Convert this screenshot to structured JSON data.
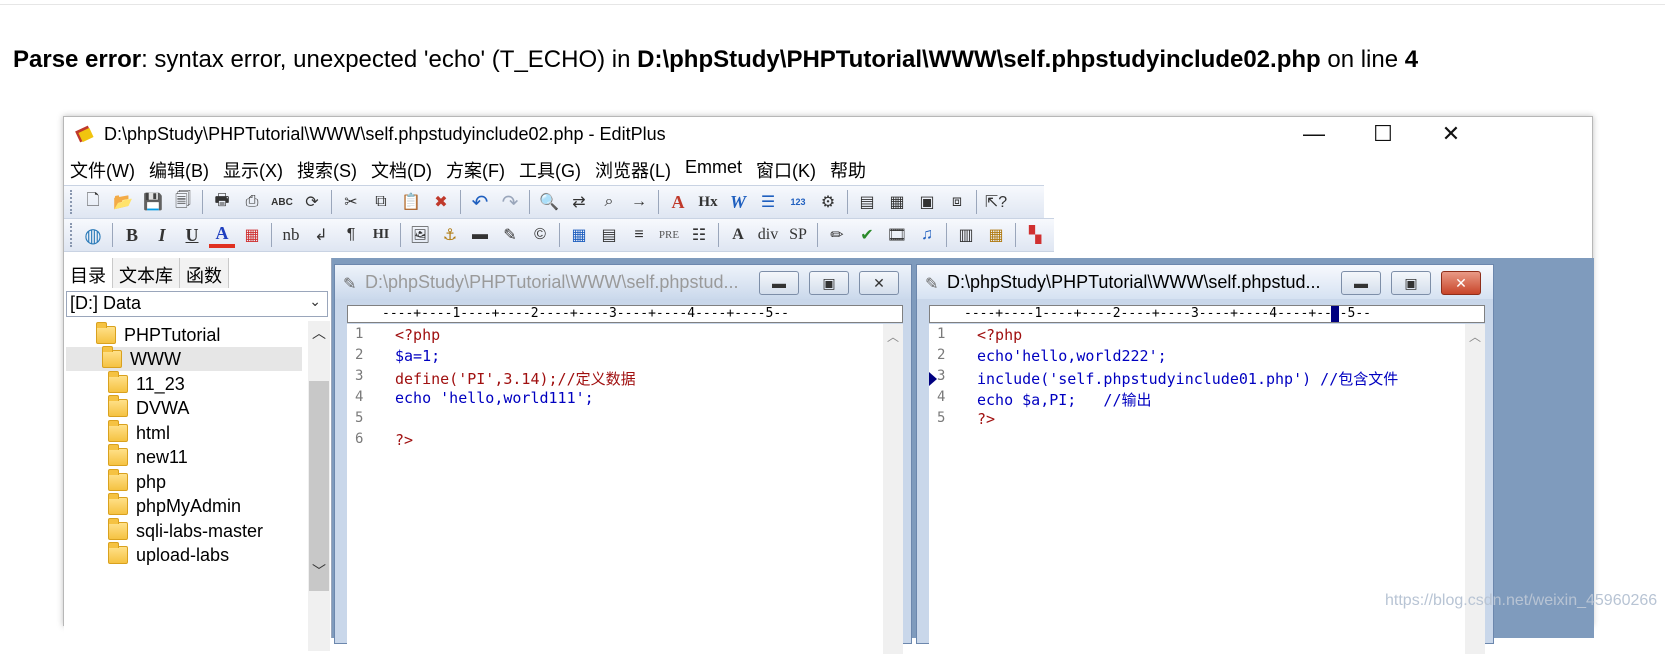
{
  "page_error": {
    "label": "Parse error",
    "message_part1": ": syntax error, unexpected 'echo' (T_ECHO) in ",
    "file": "D:\\phpStudy\\PHPTutorial\\WWW\\self.phpstudyinclude02.php",
    "message_part2": " on line ",
    "line": "4"
  },
  "window": {
    "title": "D:\\phpStudy\\PHPTutorial\\WWW\\self.phpstudyinclude02.php - EditPlus",
    "minimize": "—",
    "maximize": "☐",
    "close": "✕"
  },
  "menu": [
    "文件(W)",
    "编辑(B)",
    "显示(X)",
    "搜索(S)",
    "文档(D)",
    "方案(F)",
    "工具(G)",
    "浏览器(L)",
    "Emmet",
    "窗口(K)",
    "帮助"
  ],
  "toolbar1": {
    "icons": [
      "new-file-icon",
      "open-folder-icon",
      "save-icon",
      "save-all-icon",
      "print-preview-icon",
      "print-icon",
      "spell-check-icon",
      "browser-icon",
      "cut-icon",
      "copy-icon",
      "paste-icon",
      "delete-icon",
      "undo-icon",
      "redo-icon",
      "find-icon",
      "replace-icon",
      "find-in-files-icon",
      "goto-line-icon",
      "font-icon",
      "hex-icon",
      "word-wrap-icon",
      "indent-icon",
      "column-icon",
      "settings-icon",
      "cliptext-icon",
      "directory-icon",
      "output-icon",
      "run-icon",
      "help-icon"
    ],
    "hx_label": "Hx",
    "abc_label": "ABC"
  },
  "toolbar2": {
    "bold": "B",
    "italic": "I",
    "underline": "U",
    "font_color": "A",
    "nbsp": "nb",
    "br": "↲",
    "para": "¶",
    "hr": "HI",
    "pre": "PRE",
    "div": "div",
    "span": "SP"
  },
  "sidebar": {
    "tabs": [
      "目录",
      "文本库",
      "函数"
    ],
    "drive": "[D:] Data",
    "tree": [
      "PHPTutorial",
      "WWW",
      "11_23",
      "DVWA",
      "html",
      "new11",
      "php",
      "phpMyAdmin",
      "sqli-labs-master",
      "upload-labs"
    ]
  },
  "doc_left": {
    "title": "D:\\phpStudy\\PHPTutorial\\WWW\\self.phpstud...",
    "ruler": "----+----1----+----2----+----3----+----4----+----5--",
    "lines": [
      {
        "n": "1",
        "code": "<?php"
      },
      {
        "n": "2",
        "code": "$a=1;"
      },
      {
        "n": "3",
        "code": "define('PI',3.14);//定义数据"
      },
      {
        "n": "4",
        "code": "echo 'hello,world111';"
      },
      {
        "n": "5",
        "code": ""
      },
      {
        "n": "6",
        "code": "?>"
      }
    ]
  },
  "doc_right": {
    "title": "D:\\phpStudy\\PHPTutorial\\WWW\\self.phpstud...",
    "ruler": "----+----1----+----2----+----3----+----4----+----5--",
    "lines": [
      {
        "n": "1",
        "code": "<?php"
      },
      {
        "n": "2",
        "code": "echo'hello,world222';"
      },
      {
        "n": "3",
        "code": "include('self.phpstudyinclude01.php') //包含文件"
      },
      {
        "n": "4",
        "code": "echo $a,PI;   //输出"
      },
      {
        "n": "5",
        "code": "?>"
      }
    ]
  },
  "watermark": "https://blog.csdn.net/weixin_45960266"
}
